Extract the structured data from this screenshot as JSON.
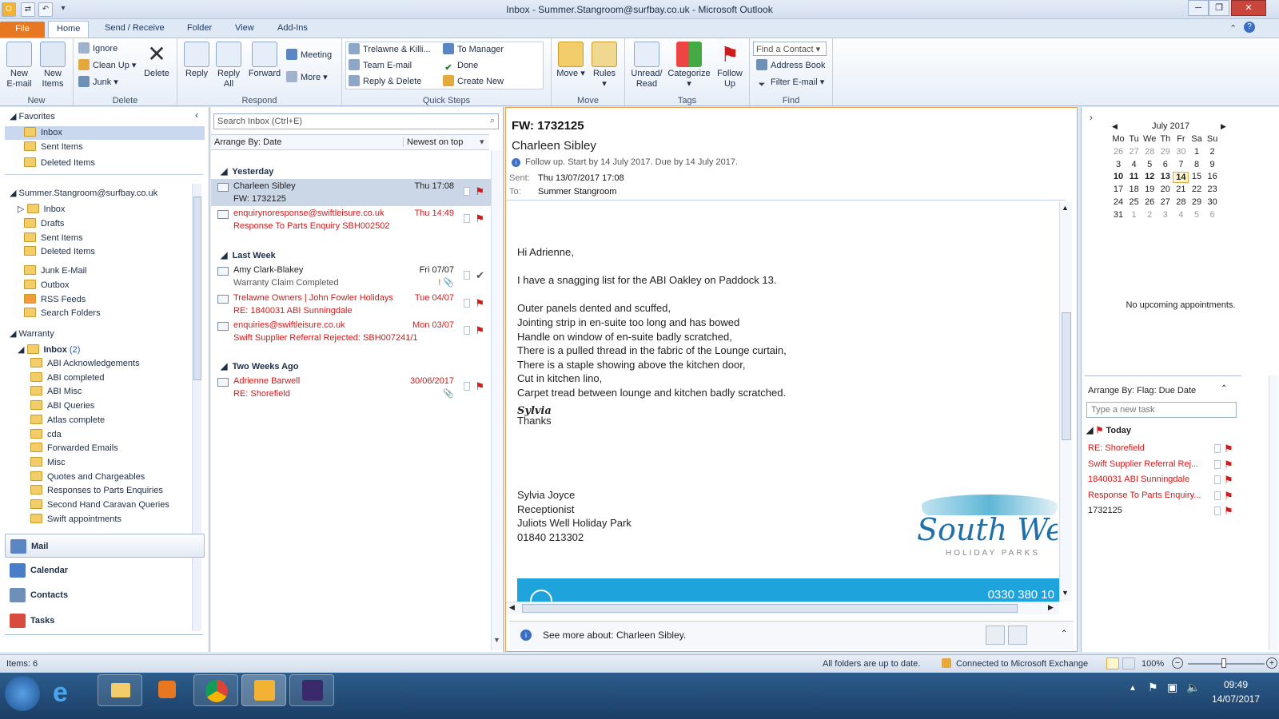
{
  "window": {
    "title": "Inbox - Summer.Stangroom@surfbay.co.uk  -  Microsoft Outlook"
  },
  "tabs": [
    "File",
    "Home",
    "Send / Receive",
    "Folder",
    "View",
    "Add-Ins"
  ],
  "ribbon": {
    "new": {
      "new_email": "New\nE-mail",
      "new_items": "New\nItems",
      "label": "New"
    },
    "delete": {
      "ignore": "Ignore",
      "cleanup": "Clean Up",
      "junk": "Junk",
      "delete": "Delete",
      "label": "Delete"
    },
    "respond": {
      "reply": "Reply",
      "reply_all": "Reply\nAll",
      "forward": "Forward",
      "meeting": "Meeting",
      "more": "More",
      "label": "Respond"
    },
    "quicksteps": {
      "items": [
        "Trelawne & Killi...",
        "Team E-mail",
        "Reply & Delete",
        "To Manager",
        "Done",
        "Create New"
      ],
      "label": "Quick Steps"
    },
    "move": {
      "move": "Move",
      "rules": "Rules",
      "label": "Move"
    },
    "tags": {
      "unread": "Unread/\nRead",
      "categorize": "Categorize",
      "followup": "Follow\nUp",
      "label": "Tags"
    },
    "find": {
      "find_contact": "Find a Contact",
      "address_book": "Address Book",
      "filter": "Filter E-mail",
      "label": "Find"
    }
  },
  "nav": {
    "favorites": "Favorites",
    "fav_items": [
      "Inbox",
      "Sent Items",
      "Deleted Items"
    ],
    "account": "Summer.Stangroom@surfbay.co.uk",
    "account_items": [
      "Inbox",
      "Drafts",
      "Sent Items",
      "Deleted Items",
      "Junk E-Mail",
      "Outbox",
      "RSS Feeds",
      "Search Folders"
    ],
    "warranty": "Warranty",
    "warranty_inbox": "Inbox",
    "warranty_inbox_count": "(2)",
    "warranty_items": [
      "ABI Acknowledgements",
      "ABI completed",
      "ABI Misc",
      "ABI Queries",
      "Atlas complete",
      "cda",
      "Forwarded Emails",
      "Misc",
      "Quotes and Chargeables",
      "Responses to Parts Enquiries",
      "Second Hand Caravan Queries",
      "Swift appointments"
    ],
    "buttons": [
      "Mail",
      "Calendar",
      "Contacts",
      "Tasks"
    ]
  },
  "list": {
    "search_placeholder": "Search Inbox (Ctrl+E)",
    "arrange": "Arrange By: Date",
    "order": "Newest on top",
    "groups": [
      "Yesterday",
      "Last Week",
      "Two Weeks Ago"
    ],
    "messages": [
      {
        "from": "Charleen Sibley",
        "subject": "FW: 1732125",
        "date": "Thu 17:08"
      },
      {
        "from": "enquirynoresponse@swiftleisure.co.uk",
        "subject": "Response To Parts Enquiry SBH002502",
        "date": "Thu 14:49"
      },
      {
        "from": "Amy Clark-Blakey",
        "subject": "Warranty Claim Completed",
        "date": "Fri 07/07"
      },
      {
        "from": "Trelawne Owners  |  John Fowler Holidays",
        "subject": "RE: 1840031 ABI Sunningdale",
        "date": "Tue 04/07"
      },
      {
        "from": "enquiries@swiftleisure.co.uk",
        "subject": "Swift Supplier Referral Rejected: SBH007241/1",
        "date": "Mon 03/07"
      },
      {
        "from": "Adrienne Barwell",
        "subject": "RE: Shorefield",
        "date": "30/06/2017"
      }
    ]
  },
  "reading": {
    "subject": "FW: 1732125",
    "sender": "Charleen Sibley",
    "followup": "Follow up.  Start by 14 July 2017.  Due by 14 July 2017.",
    "sent_label": "Sent:",
    "sent": "Thu 13/07/2017 17:08",
    "to_label": "To:",
    "to": "Summer Stangroom",
    "body": [
      "Hi Adrienne,",
      "",
      "I have a snagging list for the ABI Oakley on Paddock 13.",
      "",
      "Outer panels dented and scuffed,",
      "Jointing strip in en-suite too long and has bowed",
      "Handle on window of en-suite badly scratched,",
      "There is a pulled thread in the fabric of the Lounge curtain,",
      "There is a staple showing above the kitchen door,",
      "Cut in kitchen lino,",
      "Carpet tread between lounge and kitchen badly scratched.",
      "",
      "Thanks"
    ],
    "signature": "Sylvia",
    "sig_lines": [
      "Sylvia Joyce",
      "Receptionist",
      "Juliots Well Holiday Park",
      "01840 213302"
    ],
    "logo_text": "South West",
    "logo_sub": "HOLIDAY PARKS",
    "banner_phone": "0330 380 10",
    "see_more": "See more about: Charleen Sibley."
  },
  "todo": {
    "month": "July 2017",
    "dow": [
      "Mo",
      "Tu",
      "We",
      "Th",
      "Fr",
      "Sa",
      "Su"
    ],
    "weeks": [
      [
        "26",
        "27",
        "28",
        "29",
        "30",
        "1",
        "2"
      ],
      [
        "3",
        "4",
        "5",
        "6",
        "7",
        "8",
        "9"
      ],
      [
        "10",
        "11",
        "12",
        "13",
        "14",
        "15",
        "16"
      ],
      [
        "17",
        "18",
        "19",
        "20",
        "21",
        "22",
        "23"
      ],
      [
        "24",
        "25",
        "26",
        "27",
        "28",
        "29",
        "30"
      ],
      [
        "31",
        "1",
        "2",
        "3",
        "4",
        "5",
        "6"
      ]
    ],
    "no_appt": "No upcoming appointments.",
    "arrange": "Arrange By: Flag: Due Date",
    "new_task": "Type a new task",
    "today": "Today",
    "tasks": [
      "RE: Shorefield",
      "Swift Supplier Referral Rej...",
      "1840031 ABI Sunningdale",
      "Response To Parts Enquiry...",
      "1732125"
    ]
  },
  "status": {
    "items": "Items: 6",
    "uptodate": "All folders are up to date.",
    "exchange": "Connected to Microsoft Exchange",
    "zoom": "100%"
  },
  "taskbar": {
    "time": "09:49",
    "date": "14/07/2017"
  }
}
